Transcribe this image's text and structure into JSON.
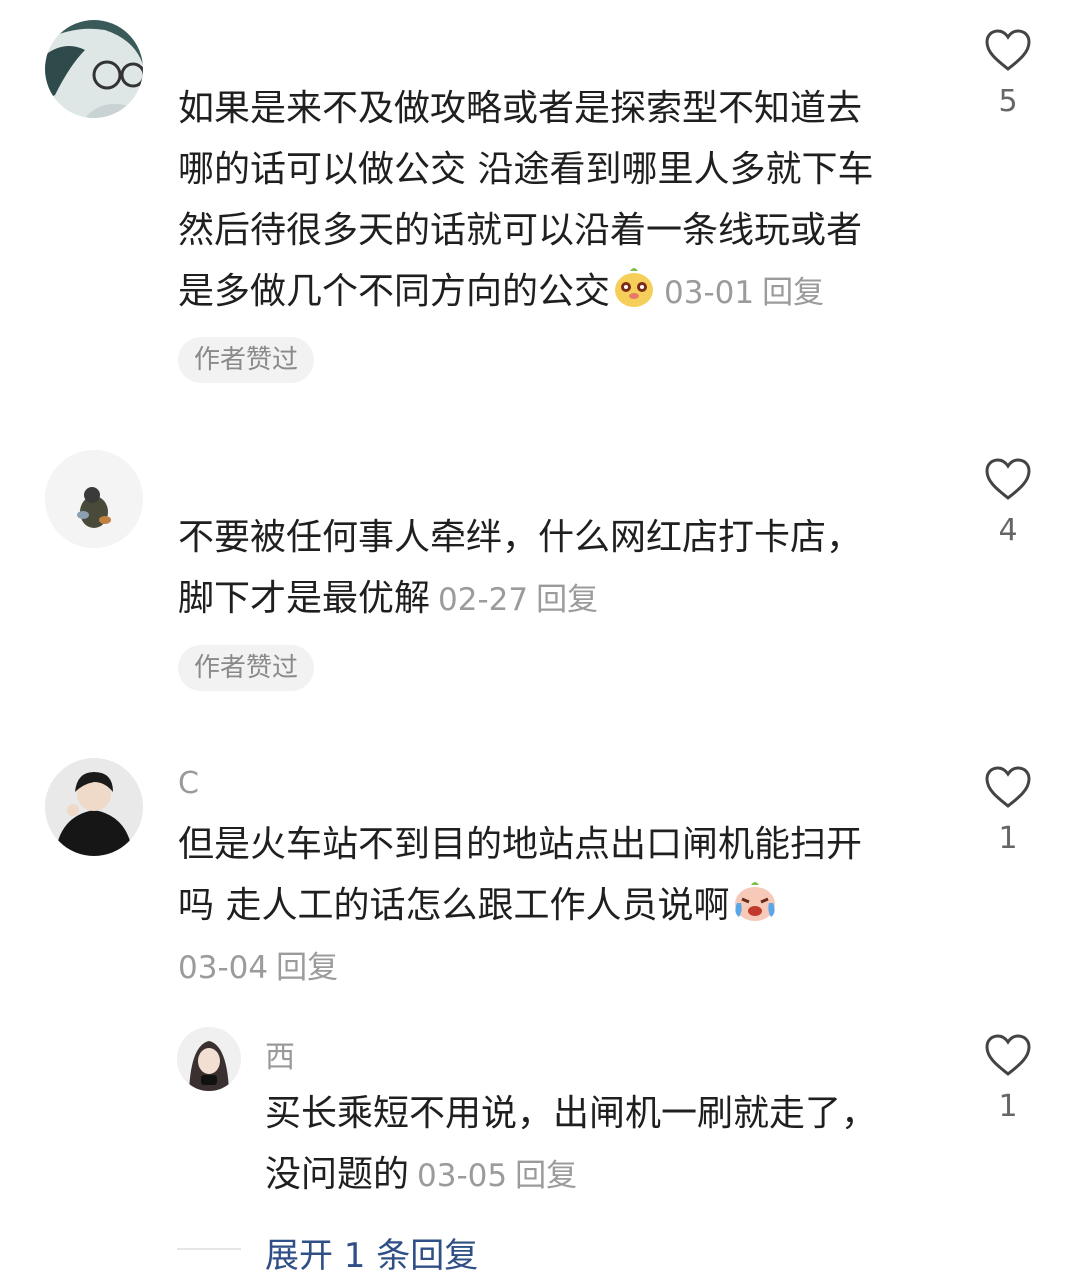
{
  "comments": [
    {
      "username": " ",
      "lines": [
        "如果是来不及做攻略或者是探索型不知道去",
        "哪的话可以做公交  沿途看到哪里人多就下车",
        "然后待很多天的话就可以沿着一条线玩或者",
        "是多做几个不同方向的公交"
      ],
      "date": "03-01",
      "reply_label": "回复",
      "badge": "作者赞过",
      "likes": "5",
      "emoji": "meerkat-face-icon"
    },
    {
      "username": " ",
      "lines": [
        "不要被任何事人牵绊，什么网红店打卡店，",
        "脚下才是最优解"
      ],
      "date": "02-27",
      "reply_label": "回复",
      "badge": "作者赞过",
      "likes": "4"
    },
    {
      "username": "C",
      "lines": [
        "但是火车站不到目的地站点出口闸机能扫开",
        "吗 走人工的话怎么跟工作人员说啊"
      ],
      "date": "03-04",
      "reply_label": "回复",
      "likes": "1",
      "emoji": "crying-face-icon"
    }
  ],
  "reply": {
    "username": "西",
    "lines": [
      "买长乘短不用说，出闸机一刷就走了，",
      "没问题的"
    ],
    "date": "03-05",
    "reply_label": "回复",
    "likes": "1"
  },
  "expand_label": "展开 1 条回复",
  "colors": {
    "text": "#1f1f1f",
    "meta": "#9b9b9b",
    "link": "#2f4f86",
    "badge_bg": "#f2f2f2"
  }
}
